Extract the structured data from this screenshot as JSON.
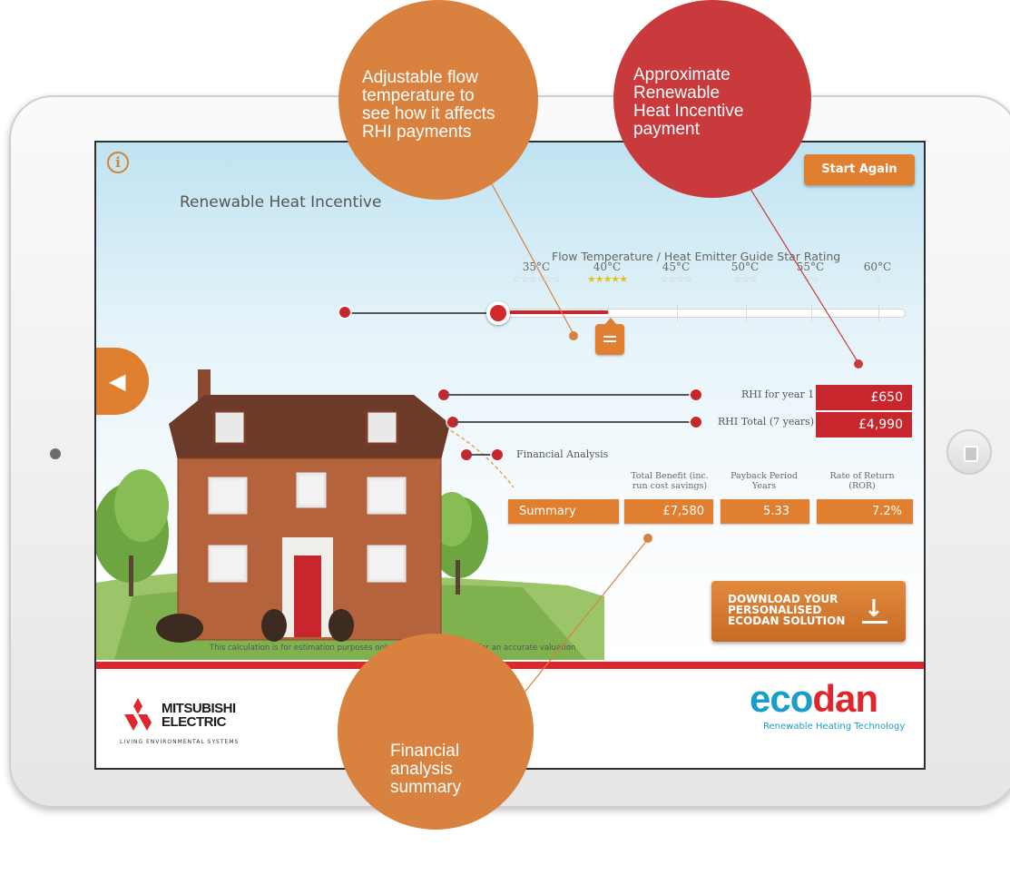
{
  "app": {
    "info_icon": "info-icon",
    "title": "Renewable Heat Incentive",
    "start_again_label": "Start Again",
    "back_icon": "chevron-left-icon"
  },
  "flow": {
    "heading": "Flow Temperature / Heat Emitter Guide Star Rating",
    "temperatures": [
      "35°C",
      "40°C",
      "45°C",
      "50°C",
      "55°C",
      "60°C"
    ],
    "stars": [
      "☆☆☆☆☆☆",
      "★★★★★",
      "☆☆☆☆",
      "☆☆☆",
      "☆☆",
      "☆"
    ],
    "selected_index": 1
  },
  "rhi": {
    "year1_label": "RHI for year 1",
    "year1_value": "£650",
    "total_label": "RHI Total (7 years)",
    "total_value": "£4,990"
  },
  "financial": {
    "label": "Financial Analysis",
    "headers": [
      "Total Benefit (inc. run cost savings)",
      "Payback Period Years",
      "Rate of Return (ROR)"
    ],
    "summary_label": "Summary",
    "total_benefit": "£7,580",
    "payback_years": "5.33",
    "ror": "7.2%"
  },
  "disclaimer": "This calculation is for estimation purposes only, a full EPC is required for an accurate valuation",
  "download": {
    "lines": [
      "DOWNLOAD YOUR",
      "PERSONALISED",
      "ECODAN SOLUTION"
    ],
    "icon": "download-icon"
  },
  "footer": {
    "mitsubishi_line1": "MITSUBISHI",
    "mitsubishi_line2": "ELECTRIC",
    "mitsubishi_sub": "LIVING ENVIRONMENTAL SYSTEMS",
    "ecodan_eco": "eco",
    "ecodan_dan": "dan",
    "ecodan_sub": "Renewable Heating Technology"
  },
  "callouts": {
    "flow": [
      "Adjustable flow",
      "temperature to",
      "see how it affects",
      "RHI payments"
    ],
    "rhi": [
      "Approximate",
      "Renewable",
      "Heat Incentive",
      "payment"
    ],
    "financial": [
      "Financial",
      "analysis",
      "summary"
    ]
  },
  "colors": {
    "orange": "#df7f2f",
    "red": "#c8262d",
    "callout_orange": "#d9823f",
    "callout_red": "#c93a3c",
    "ecodan_blue": "#1a9dc8"
  }
}
